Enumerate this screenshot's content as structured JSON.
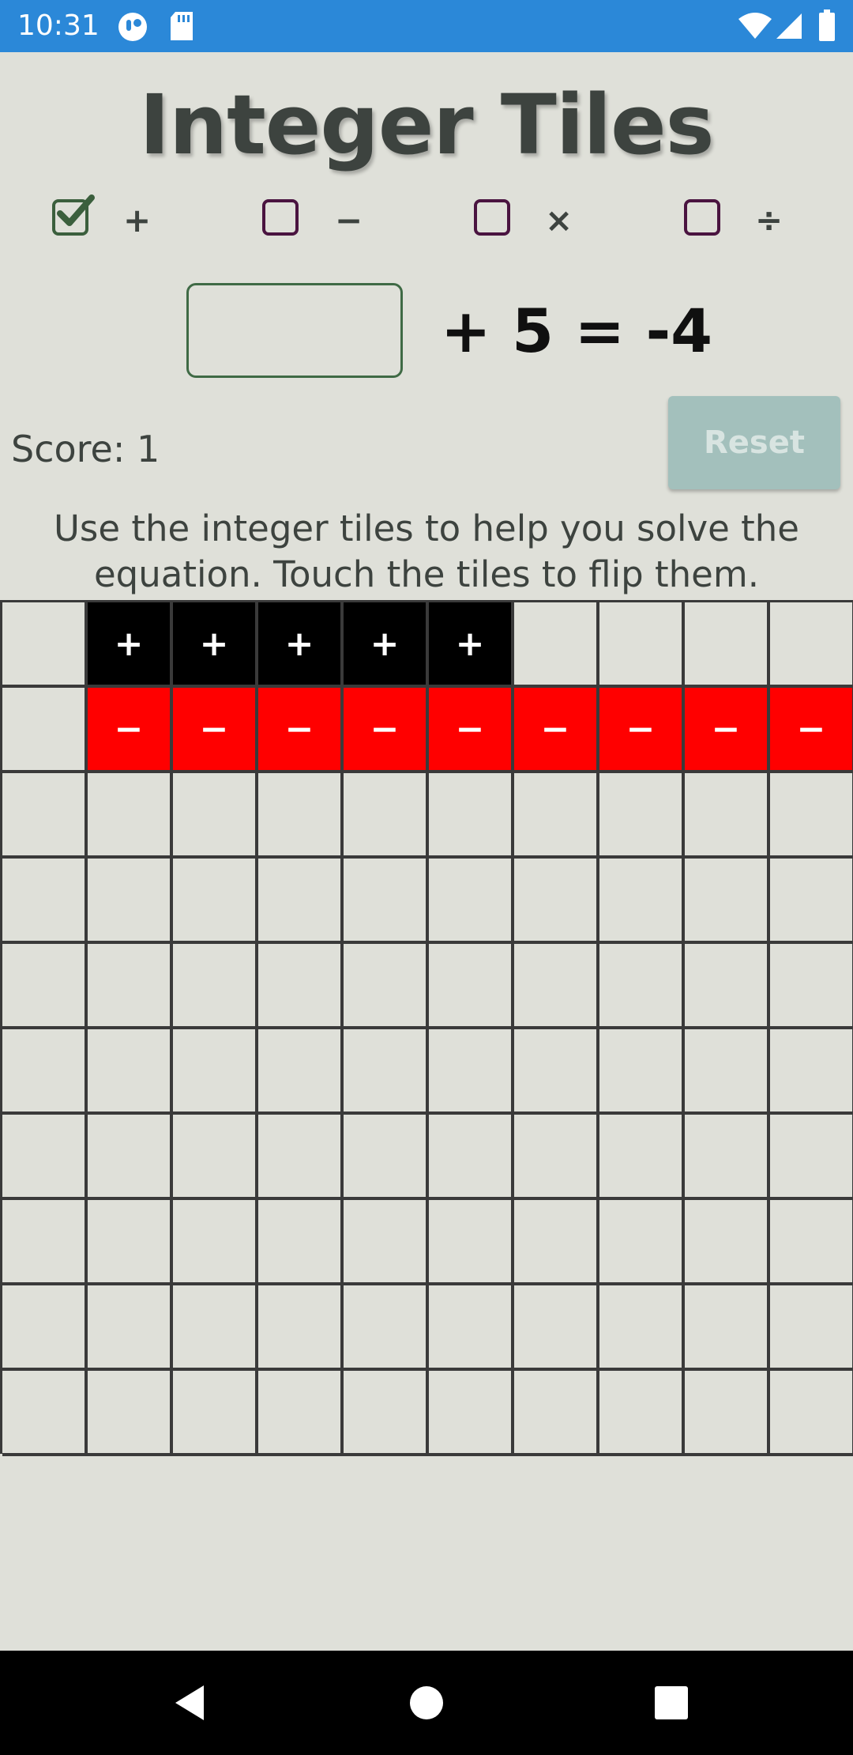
{
  "status_bar": {
    "time": "10:31",
    "icons": [
      "app-notification-icon",
      "sd-card-icon",
      "wifi-icon",
      "cell-signal-icon",
      "battery-icon"
    ]
  },
  "title": "Integer Tiles",
  "operations": [
    {
      "symbol": "+",
      "checked": true,
      "name": "addition"
    },
    {
      "symbol": "−",
      "checked": false,
      "name": "subtraction"
    },
    {
      "symbol": "×",
      "checked": false,
      "name": "multiplication"
    },
    {
      "symbol": "÷",
      "checked": false,
      "name": "division"
    }
  ],
  "equation": {
    "input_value": "",
    "rest": "+ 5 = -4"
  },
  "score_text": "Score: 1",
  "reset_label": "Reset",
  "instructions": "Use the integer tiles to help you solve the equation. Touch the tiles to flip them.",
  "grid": {
    "size": 10,
    "tiles": [
      {
        "row": 0,
        "col": 1,
        "type": "pos",
        "label": "+"
      },
      {
        "row": 0,
        "col": 2,
        "type": "pos",
        "label": "+"
      },
      {
        "row": 0,
        "col": 3,
        "type": "pos",
        "label": "+"
      },
      {
        "row": 0,
        "col": 4,
        "type": "pos",
        "label": "+"
      },
      {
        "row": 0,
        "col": 5,
        "type": "pos",
        "label": "+"
      },
      {
        "row": 1,
        "col": 1,
        "type": "neg",
        "label": "−"
      },
      {
        "row": 1,
        "col": 2,
        "type": "neg",
        "label": "−"
      },
      {
        "row": 1,
        "col": 3,
        "type": "neg",
        "label": "−"
      },
      {
        "row": 1,
        "col": 4,
        "type": "neg",
        "label": "−"
      },
      {
        "row": 1,
        "col": 5,
        "type": "neg",
        "label": "−"
      },
      {
        "row": 1,
        "col": 6,
        "type": "neg",
        "label": "−"
      },
      {
        "row": 1,
        "col": 7,
        "type": "neg",
        "label": "−"
      },
      {
        "row": 1,
        "col": 8,
        "type": "neg",
        "label": "−"
      },
      {
        "row": 1,
        "col": 9,
        "type": "neg",
        "label": "−"
      }
    ]
  },
  "colors": {
    "background": "#dfe0d9",
    "status_bar": "#2b88d8",
    "positive_tile": "#000000",
    "negative_tile": "#ff0000",
    "reset_button": "#a3c0bc",
    "checkbox_checked": "#3b5f3d",
    "checkbox_unchecked": "#4a1440"
  },
  "nav_bar": {
    "buttons": [
      "back-icon",
      "home-icon",
      "recents-icon"
    ]
  }
}
